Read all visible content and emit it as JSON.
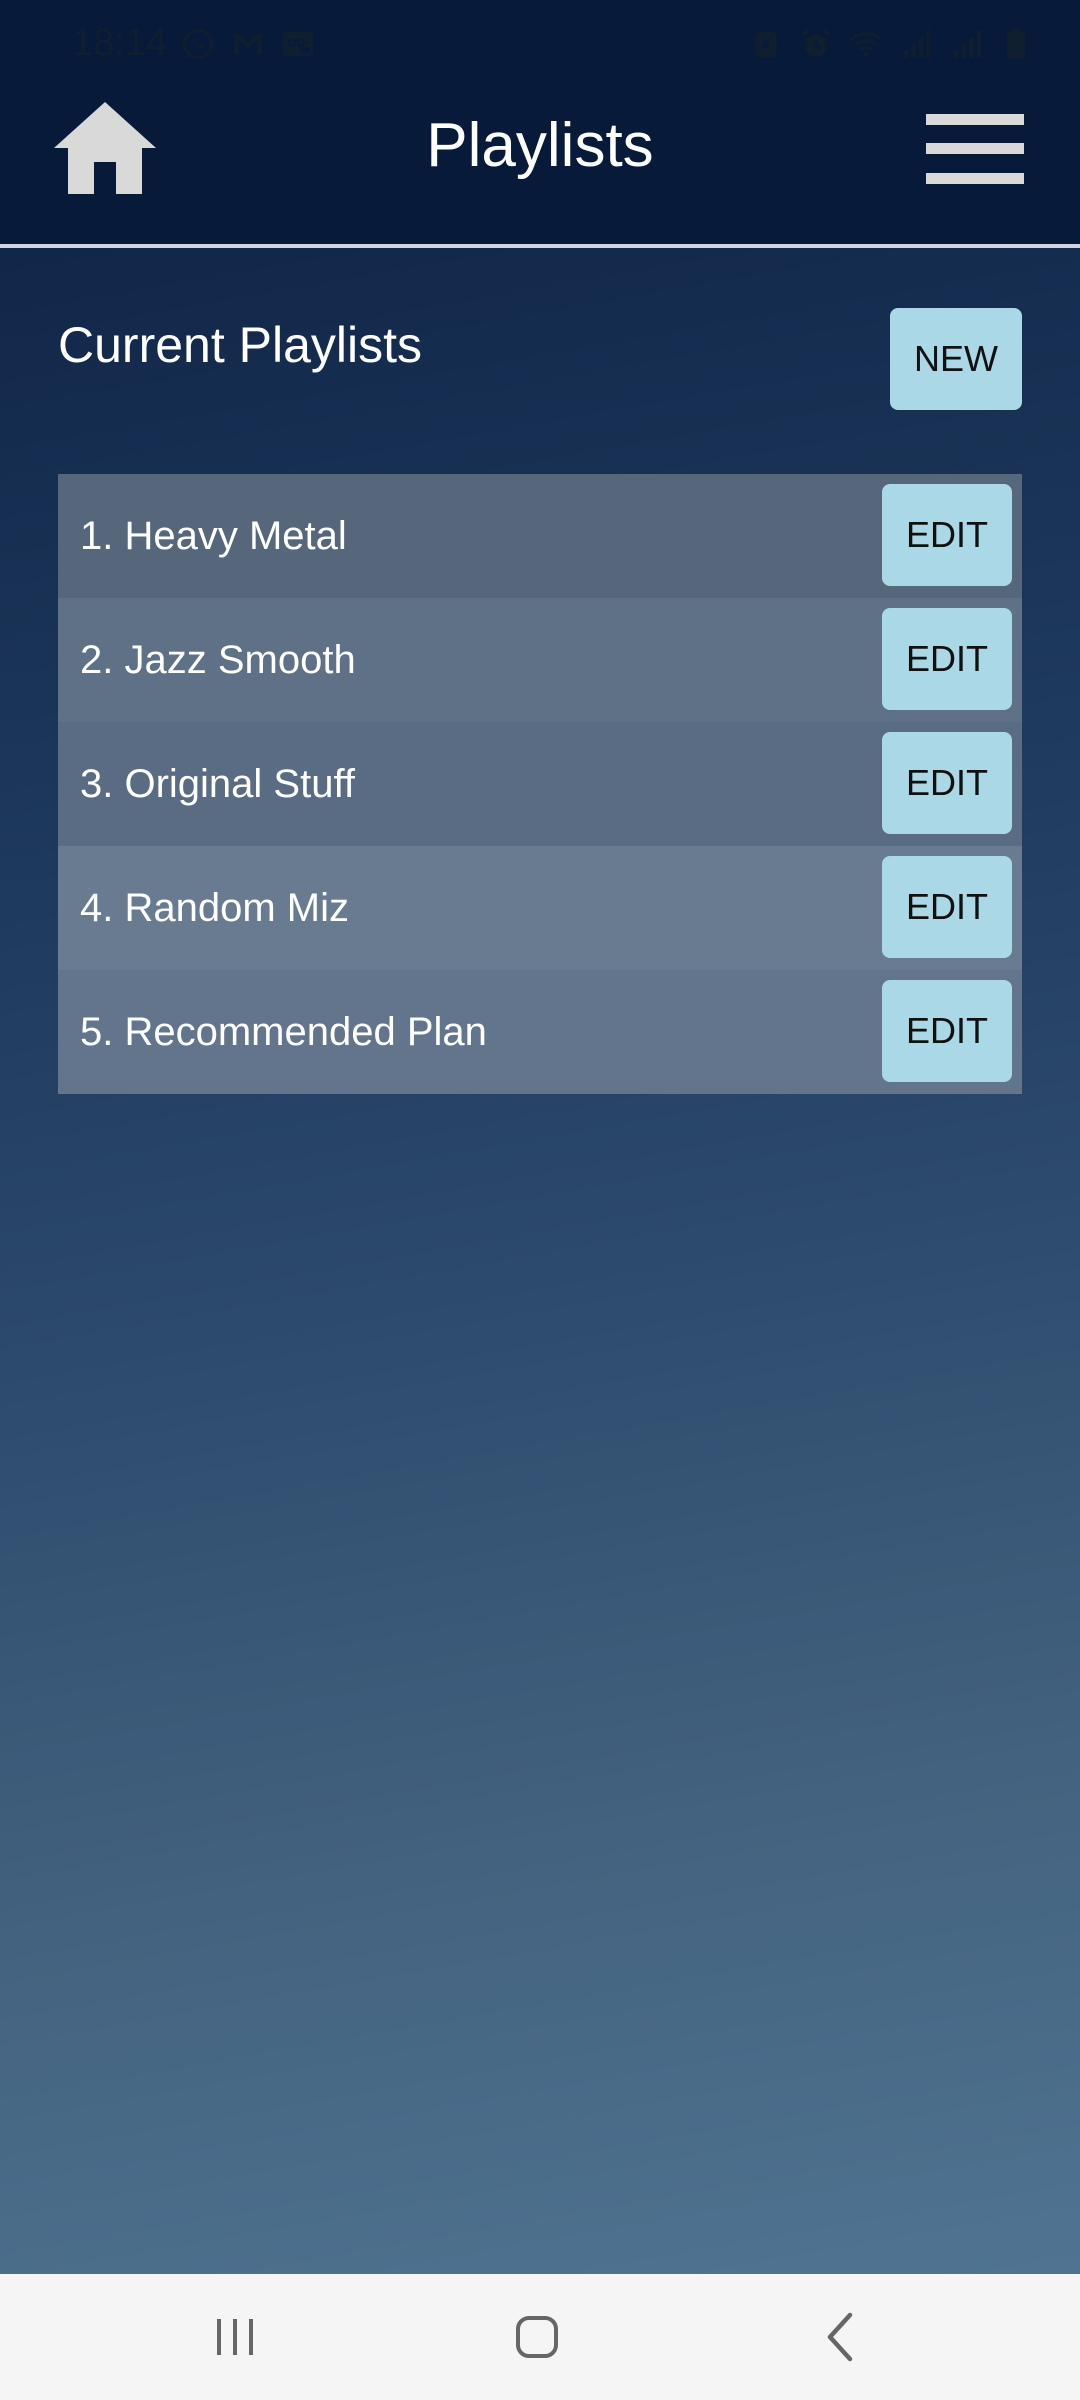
{
  "status_bar": {
    "time": "18:14",
    "left_icons": [
      "whatsapp-icon",
      "gmail-icon",
      "voicemail-icon"
    ],
    "right_icons": [
      "lock-icon",
      "alarm-icon",
      "wifi-icon",
      "signal-icon",
      "signal-icon",
      "battery-icon"
    ]
  },
  "header": {
    "title": "Playlists",
    "home_icon": "home-icon",
    "menu_icon": "hamburger-menu-icon"
  },
  "section": {
    "title": "Current Playlists",
    "new_label": "NEW"
  },
  "playlists": [
    {
      "label": "1. Heavy Metal",
      "edit_label": "EDIT",
      "row_color": "#56677c"
    },
    {
      "label": "2. Jazz Smooth",
      "edit_label": "EDIT",
      "row_color": "#5f7187"
    },
    {
      "label": "3. Original Stuff",
      "edit_label": "EDIT",
      "row_color": "#5a6c83"
    },
    {
      "label": "4. Random Miz",
      "edit_label": "EDIT",
      "row_color": "#687b91"
    },
    {
      "label": "5. Recommended Plan",
      "edit_label": "EDIT",
      "row_color": "#62758c"
    }
  ],
  "nav_bar": {
    "buttons": [
      "recent-apps-icon",
      "home-circle-icon",
      "back-icon"
    ]
  },
  "colors": {
    "header_bg": "#081a3a",
    "button_bg": "#abd8e6",
    "nav_bg": "#f5f5f5"
  }
}
